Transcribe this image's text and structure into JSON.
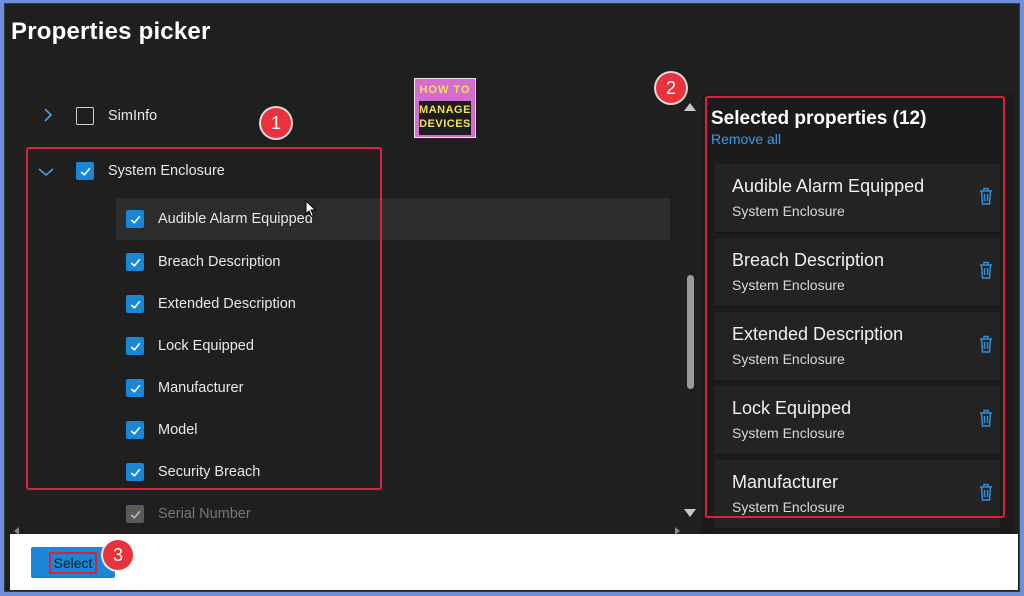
{
  "title": "Properties picker",
  "tree": {
    "collapsed_item": {
      "label": "SimInfo",
      "checked": false
    },
    "group": {
      "label": "System Enclosure",
      "checked": true,
      "expanded": true
    },
    "children": [
      {
        "label": "Audible Alarm Equipped",
        "checked": true
      },
      {
        "label": "Breach Description",
        "checked": true
      },
      {
        "label": "Extended Description",
        "checked": true
      },
      {
        "label": "Lock Equipped",
        "checked": true
      },
      {
        "label": "Manufacturer",
        "checked": true
      },
      {
        "label": "Model",
        "checked": true
      },
      {
        "label": "Security Breach",
        "checked": true
      },
      {
        "label": "Serial Number",
        "checked": true,
        "disabled": true
      }
    ]
  },
  "selected": {
    "title": "Selected properties (12)",
    "remove_all": "Remove all",
    "items": [
      {
        "name": "Audible Alarm Equipped",
        "category": "System Enclosure"
      },
      {
        "name": "Breach Description",
        "category": "System Enclosure"
      },
      {
        "name": "Extended Description",
        "category": "System Enclosure"
      },
      {
        "name": "Lock Equipped",
        "category": "System Enclosure"
      },
      {
        "name": "Manufacturer",
        "category": "System Enclosure"
      }
    ]
  },
  "footer": {
    "select_label": "Select"
  },
  "annotations": {
    "badge1": "1",
    "badge2": "2",
    "badge3": "3"
  },
  "logo": {
    "line1": "HOW TO",
    "line2": "MANAGE",
    "line3": "DEVICES"
  },
  "colors": {
    "accent": "#1a86d6",
    "link": "#3c9ae8",
    "highlight_box": "#e01f3d",
    "badge": "#e9323b",
    "background": "#1f1f1f"
  },
  "icons": {
    "expand": "chevron-right-icon",
    "collapse": "chevron-down-icon",
    "check": "checkmark-icon",
    "delete": "trash-icon"
  }
}
